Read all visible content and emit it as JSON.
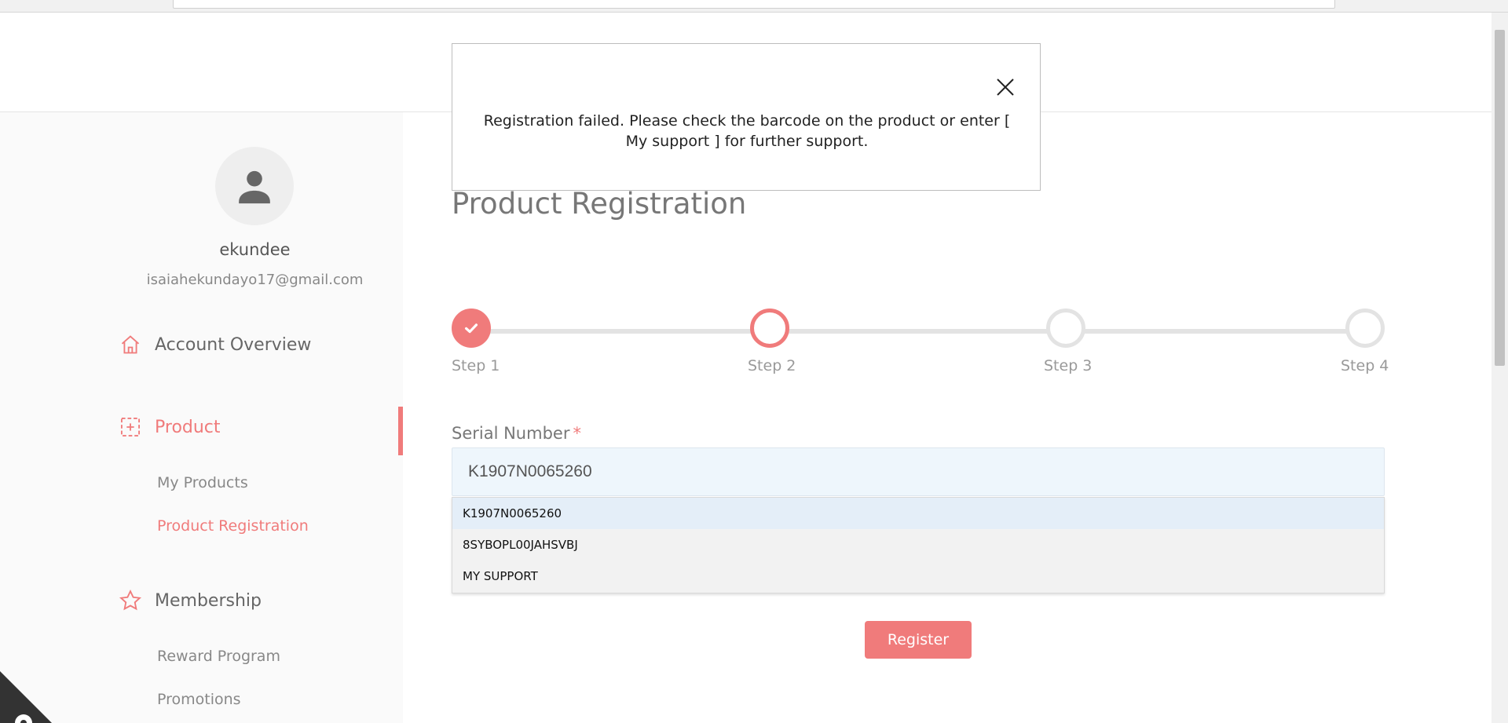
{
  "user": {
    "name": "ekundee",
    "email": "isaiahekundayo17@gmail.com"
  },
  "sidebar": {
    "account_overview": "Account Overview",
    "product": "Product",
    "my_products": "My Products",
    "product_registration": "Product Registration",
    "membership": "Membership",
    "reward_program": "Reward Program",
    "promotions": "Promotions"
  },
  "main": {
    "title": "Product Registration",
    "steps": [
      "Step 1",
      "Step 2",
      "Step 3",
      "Step 4"
    ],
    "current_step": 2,
    "serial_label": "Serial Number",
    "required_mark": "*",
    "serial_value": "K1907N0065260",
    "suggestions": [
      "K1907N0065260",
      "8SYBOPL00JAHSVBJ",
      "MY SUPPORT"
    ],
    "register_label": "Register"
  },
  "modal": {
    "message": "Registration failed. Please check the barcode on the product or enter [ My support ] for further support."
  },
  "colors": {
    "accent": "#f07b7b",
    "input_bg": "#eef6fc",
    "sidebar_bg": "#fafafa"
  }
}
